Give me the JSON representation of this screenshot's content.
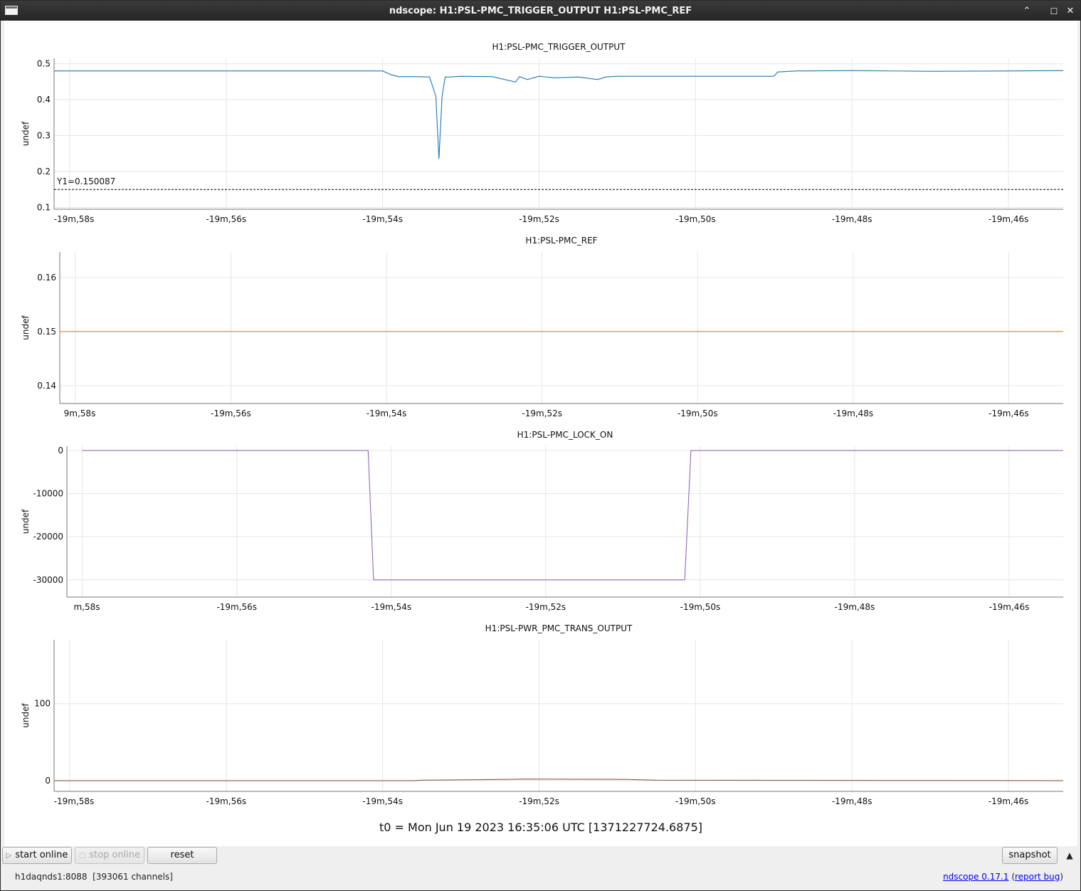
{
  "window": {
    "title": "ndscope: H1:PSL-PMC_TRIGGER_OUTPUT H1:PSL-PMC_REF",
    "controls": {
      "minimize": "⌃",
      "maximize": "☐",
      "close": "✕"
    },
    "icon": "window-app-icon"
  },
  "plots": [
    {
      "title": "H1:PSL-PMC_TRIGGER_OUTPUT",
      "ylabel": "undef",
      "color": "#1f77b4",
      "ylim": [
        0.095,
        0.515
      ],
      "yticks": [
        "0.5",
        "0.4",
        "0.3",
        "0.2",
        "0.1"
      ],
      "ytick_values": [
        0.5,
        0.4,
        0.3,
        0.2,
        0.1
      ],
      "xticks": [
        "-19m,58s",
        "-19m,56s",
        "-19m,54s",
        "-19m,52s",
        "-19m,50s",
        "-19m,48s",
        "-19m,46s"
      ],
      "cursor": {
        "label": "Y1=0.150087",
        "value": 0.150087
      }
    },
    {
      "title": "H1:PSL-PMC_REF",
      "ylabel": "undef",
      "color": "#ff7f0e",
      "ylim": [
        0.1367,
        0.1647
      ],
      "yticks": [
        "0.16",
        "0.15",
        "0.14"
      ],
      "ytick_values": [
        0.16,
        0.15,
        0.14
      ],
      "xticks": [
        "9m,58s",
        "-19m,56s",
        "-19m,54s",
        "-19m,52s",
        "-19m,50s",
        "-19m,48s",
        "-19m,46s"
      ]
    },
    {
      "title": "H1:PSL-PMC_LOCK_ON",
      "ylabel": "undef",
      "color": "#9467bd",
      "ylim": [
        -34000,
        1000
      ],
      "yticks": [
        "0",
        "-10000",
        "-20000",
        "-30000"
      ],
      "ytick_values": [
        0,
        -10000,
        -20000,
        -30000
      ],
      "xticks": [
        "m,58s",
        "-19m,56s",
        "-19m,54s",
        "-19m,52s",
        "-19m,50s",
        "-19m,48s",
        "-19m,46s"
      ]
    },
    {
      "title": "H1:PSL-PWR_PMC_TRANS_OUTPUT",
      "ylabel": "undef",
      "color": "#8c564b",
      "ylim": [
        -14,
        183
      ],
      "yticks": [
        "100",
        "0"
      ],
      "ytick_values": [
        100,
        0
      ],
      "xticks": [
        "-19m,58s",
        "-19m,56s",
        "-19m,54s",
        "-19m,52s",
        "-19m,50s",
        "-19m,48s",
        "-19m,46s"
      ]
    }
  ],
  "chart_data": [
    {
      "type": "line",
      "title": "H1:PSL-PMC_TRIGGER_OUTPUT",
      "xlabel": "",
      "ylabel": "undef",
      "x_unit": "seconds relative to t0",
      "xlim": [
        -1198.2,
        -1185.3
      ],
      "ylim": [
        0.095,
        0.515
      ],
      "x_ticks": [
        -1198,
        -1196,
        -1194,
        -1192,
        -1190,
        -1188,
        -1186
      ],
      "y_ticks": [
        0.1,
        0.2,
        0.3,
        0.4,
        0.5
      ],
      "series": [
        {
          "x": [
            -1198.2,
            -1194.0,
            -1193.9,
            -1193.8,
            -1193.6,
            -1193.4,
            -1193.32,
            -1193.28,
            -1193.24,
            -1193.2,
            -1193.15,
            -1193.0,
            -1192.6,
            -1192.3,
            -1192.25,
            -1192.15,
            -1192.0,
            -1191.8,
            -1191.5,
            -1191.25,
            -1191.15,
            -1191.0,
            -1190.5,
            -1189.0,
            -1188.95,
            -1188.7,
            -1188.0,
            -1187.0,
            -1186.0,
            -1185.3
          ],
          "y": [
            0.48,
            0.48,
            0.47,
            0.464,
            0.464,
            0.463,
            0.41,
            0.235,
            0.41,
            0.463,
            0.463,
            0.465,
            0.464,
            0.449,
            0.464,
            0.456,
            0.465,
            0.461,
            0.463,
            0.456,
            0.463,
            0.465,
            0.465,
            0.465,
            0.477,
            0.48,
            0.481,
            0.479,
            0.48,
            0.481
          ]
        }
      ],
      "cursor_y": 0.150087,
      "grid": true
    },
    {
      "type": "line",
      "title": "H1:PSL-PMC_REF",
      "xlabel": "",
      "ylabel": "undef",
      "x_unit": "seconds relative to t0",
      "xlim": [
        -1198.2,
        -1185.3
      ],
      "ylim": [
        0.1367,
        0.1647
      ],
      "x_ticks": [
        -1198,
        -1196,
        -1194,
        -1192,
        -1190,
        -1188,
        -1186
      ],
      "y_ticks": [
        0.14,
        0.15,
        0.16
      ],
      "series": [
        {
          "x": [
            -1198.2,
            -1185.3
          ],
          "y": [
            0.15,
            0.15
          ]
        }
      ],
      "grid": true
    },
    {
      "type": "line",
      "title": "H1:PSL-PMC_LOCK_ON",
      "xlabel": "",
      "ylabel": "undef",
      "x_unit": "seconds relative to t0",
      "xlim": [
        -1198.2,
        -1185.3
      ],
      "ylim": [
        -34000,
        1000
      ],
      "x_ticks": [
        -1198,
        -1196,
        -1194,
        -1192,
        -1190,
        -1188,
        -1186
      ],
      "y_ticks": [
        -30000,
        -20000,
        -10000,
        0
      ],
      "series": [
        {
          "x": [
            -1198.0,
            -1194.3,
            -1194.23,
            -1190.2,
            -1190.12,
            -1185.3
          ],
          "y": [
            0,
            0,
            -30000,
            -30000,
            0,
            0
          ]
        }
      ],
      "grid": true
    },
    {
      "type": "line",
      "title": "H1:PSL-PWR_PMC_TRANS_OUTPUT",
      "xlabel": "",
      "ylabel": "undef",
      "x_unit": "seconds relative to t0",
      "xlim": [
        -1198.2,
        -1185.3
      ],
      "ylim": [
        -14,
        183
      ],
      "x_ticks": [
        -1198,
        -1196,
        -1194,
        -1192,
        -1190,
        -1188,
        -1186
      ],
      "y_ticks": [
        0,
        100
      ],
      "series": [
        {
          "x": [
            -1198.2,
            -1193.6,
            -1193.5,
            -1192.4,
            -1192.2,
            -1190.9,
            -1190.5,
            -1185.3
          ],
          "y": [
            0,
            0,
            0.5,
            1.5,
            2,
            1.5,
            0.5,
            0
          ]
        }
      ],
      "grid": true
    }
  ],
  "t0_label": "t0 = Mon Jun 19 2023 16:35:06 UTC [1371227724.6875]",
  "toolbar": {
    "start_online": "start online",
    "start_online_icon": "play-icon",
    "stop_online": "stop online",
    "stop_online_icon": "stop-icon",
    "reset": "reset",
    "snapshot": "snapshot",
    "collapse_icon": "triangle-up-icon"
  },
  "status": {
    "server": "h1daqnds1:8088  [393061 channels]",
    "version_link": "ndscope 0.17.1",
    "report_link": "report bug",
    "paren_open": "(",
    "paren_close": ")"
  }
}
